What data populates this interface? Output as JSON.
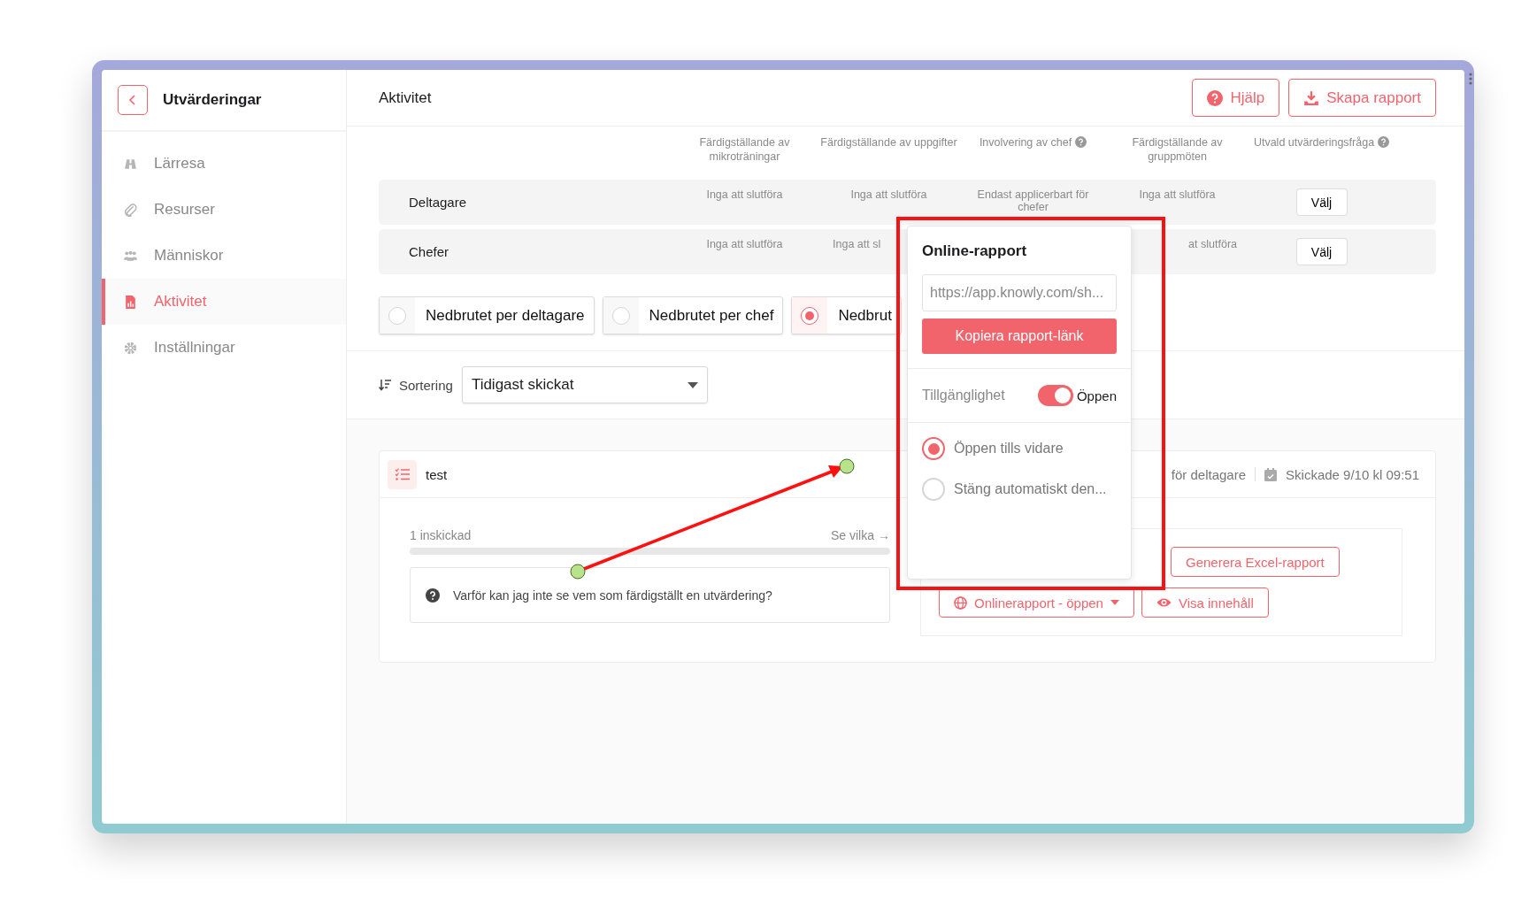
{
  "sidebar": {
    "title": "Utvärderingar",
    "items": [
      {
        "label": "Lärresa",
        "selected": false
      },
      {
        "label": "Resurser",
        "selected": false
      },
      {
        "label": "Människor",
        "selected": false
      },
      {
        "label": "Aktivitet",
        "selected": true
      },
      {
        "label": "Inställningar",
        "selected": false
      }
    ]
  },
  "header": {
    "title": "Aktivitet",
    "buttons": [
      {
        "label": "Hjälp"
      },
      {
        "label": "Skapa rapport"
      }
    ]
  },
  "table": {
    "columns": [
      {
        "label": "Färdigställande av mikroträningar",
        "help": false
      },
      {
        "label": "Färdigställande av uppgifter",
        "help": false
      },
      {
        "label": "Involvering av chef",
        "help": true
      },
      {
        "label": "Färdigställande av gruppmöten",
        "help": false
      },
      {
        "label": "Utvald utvärderingsfråga",
        "help": true
      }
    ],
    "rows": [
      {
        "label": "Deltagare",
        "cells": [
          {
            "text": "Inga att slutföra"
          },
          {
            "text": "Inga att slutföra"
          },
          {
            "text": "Endast applicerbart för chefer"
          },
          {
            "text": "Inga att slutföra"
          }
        ],
        "action": "Välj"
      },
      {
        "label": "Chefer",
        "cells": [
          {
            "text": "Inga att slutföra"
          },
          {
            "text": "Inga att sl",
            "kind": "clipped"
          },
          null,
          {
            "text": "at slutföra",
            "kind": "remnant"
          }
        ],
        "action": "Välj"
      }
    ]
  },
  "breakdown": [
    {
      "label": "Nedbrutet per deltagare",
      "selected": false
    },
    {
      "label": "Nedbrutet per chef",
      "selected": false
    },
    {
      "label": "Nedbrut",
      "selected": true
    }
  ],
  "sort": {
    "label": "Sortering",
    "value": "Tidigast skickat"
  },
  "card": {
    "title": "test",
    "meta": [
      "för deltagare",
      "Skickade 9/10 kl 09:51"
    ],
    "submitted": "1 inskickad",
    "see_link": "Se vilka",
    "see_arrow": "→",
    "level": 0,
    "question": "Varför kan jag inte se vem som färdigställt en utvärdering?",
    "buttons": [
      {
        "label": "Generera Excel-rapport",
        "kind": "plain"
      },
      {
        "label": "Onlinerapport - öppen",
        "kind": "dropdown"
      },
      {
        "label": "Visa innehåll",
        "kind": "view"
      }
    ]
  },
  "popover": {
    "title": "Online-rapport",
    "url": "https://app.knowly.com/sh...",
    "copy_button": "Kopiera rapport-länk",
    "availability": {
      "label": "Tillgänglighet",
      "on": true,
      "state_label": "Öppen"
    },
    "options": [
      {
        "label": "Öppen tills vidare",
        "selected": true
      },
      {
        "label": "Stäng automatiskt den...",
        "selected": false
      }
    ]
  }
}
